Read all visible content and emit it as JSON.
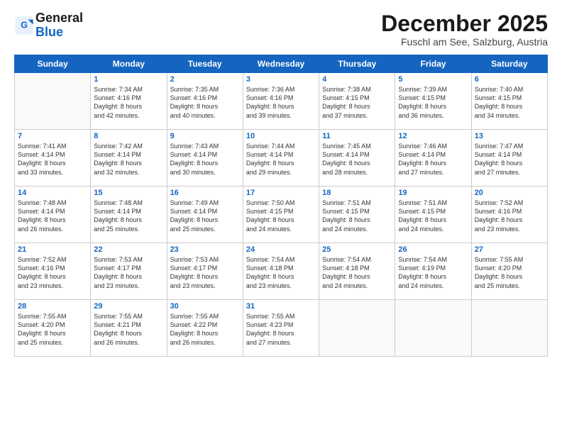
{
  "logo": {
    "line1": "General",
    "line2": "Blue"
  },
  "title": "December 2025",
  "subtitle": "Fuschl am See, Salzburg, Austria",
  "days_of_week": [
    "Sunday",
    "Monday",
    "Tuesday",
    "Wednesday",
    "Thursday",
    "Friday",
    "Saturday"
  ],
  "weeks": [
    [
      {
        "num": "",
        "info": ""
      },
      {
        "num": "1",
        "info": "Sunrise: 7:34 AM\nSunset: 4:16 PM\nDaylight: 8 hours\nand 42 minutes."
      },
      {
        "num": "2",
        "info": "Sunrise: 7:35 AM\nSunset: 4:16 PM\nDaylight: 8 hours\nand 40 minutes."
      },
      {
        "num": "3",
        "info": "Sunrise: 7:36 AM\nSunset: 4:16 PM\nDaylight: 8 hours\nand 39 minutes."
      },
      {
        "num": "4",
        "info": "Sunrise: 7:38 AM\nSunset: 4:15 PM\nDaylight: 8 hours\nand 37 minutes."
      },
      {
        "num": "5",
        "info": "Sunrise: 7:39 AM\nSunset: 4:15 PM\nDaylight: 8 hours\nand 36 minutes."
      },
      {
        "num": "6",
        "info": "Sunrise: 7:40 AM\nSunset: 4:15 PM\nDaylight: 8 hours\nand 34 minutes."
      }
    ],
    [
      {
        "num": "7",
        "info": "Sunrise: 7:41 AM\nSunset: 4:14 PM\nDaylight: 8 hours\nand 33 minutes."
      },
      {
        "num": "8",
        "info": "Sunrise: 7:42 AM\nSunset: 4:14 PM\nDaylight: 8 hours\nand 32 minutes."
      },
      {
        "num": "9",
        "info": "Sunrise: 7:43 AM\nSunset: 4:14 PM\nDaylight: 8 hours\nand 30 minutes."
      },
      {
        "num": "10",
        "info": "Sunrise: 7:44 AM\nSunset: 4:14 PM\nDaylight: 8 hours\nand 29 minutes."
      },
      {
        "num": "11",
        "info": "Sunrise: 7:45 AM\nSunset: 4:14 PM\nDaylight: 8 hours\nand 28 minutes."
      },
      {
        "num": "12",
        "info": "Sunrise: 7:46 AM\nSunset: 4:14 PM\nDaylight: 8 hours\nand 27 minutes."
      },
      {
        "num": "13",
        "info": "Sunrise: 7:47 AM\nSunset: 4:14 PM\nDaylight: 8 hours\nand 27 minutes."
      }
    ],
    [
      {
        "num": "14",
        "info": "Sunrise: 7:48 AM\nSunset: 4:14 PM\nDaylight: 8 hours\nand 26 minutes."
      },
      {
        "num": "15",
        "info": "Sunrise: 7:48 AM\nSunset: 4:14 PM\nDaylight: 8 hours\nand 25 minutes."
      },
      {
        "num": "16",
        "info": "Sunrise: 7:49 AM\nSunset: 4:14 PM\nDaylight: 8 hours\nand 25 minutes."
      },
      {
        "num": "17",
        "info": "Sunrise: 7:50 AM\nSunset: 4:15 PM\nDaylight: 8 hours\nand 24 minutes."
      },
      {
        "num": "18",
        "info": "Sunrise: 7:51 AM\nSunset: 4:15 PM\nDaylight: 8 hours\nand 24 minutes."
      },
      {
        "num": "19",
        "info": "Sunrise: 7:51 AM\nSunset: 4:15 PM\nDaylight: 8 hours\nand 24 minutes."
      },
      {
        "num": "20",
        "info": "Sunrise: 7:52 AM\nSunset: 4:16 PM\nDaylight: 8 hours\nand 23 minutes."
      }
    ],
    [
      {
        "num": "21",
        "info": "Sunrise: 7:52 AM\nSunset: 4:16 PM\nDaylight: 8 hours\nand 23 minutes."
      },
      {
        "num": "22",
        "info": "Sunrise: 7:53 AM\nSunset: 4:17 PM\nDaylight: 8 hours\nand 23 minutes."
      },
      {
        "num": "23",
        "info": "Sunrise: 7:53 AM\nSunset: 4:17 PM\nDaylight: 8 hours\nand 23 minutes."
      },
      {
        "num": "24",
        "info": "Sunrise: 7:54 AM\nSunset: 4:18 PM\nDaylight: 8 hours\nand 23 minutes."
      },
      {
        "num": "25",
        "info": "Sunrise: 7:54 AM\nSunset: 4:18 PM\nDaylight: 8 hours\nand 24 minutes."
      },
      {
        "num": "26",
        "info": "Sunrise: 7:54 AM\nSunset: 4:19 PM\nDaylight: 8 hours\nand 24 minutes."
      },
      {
        "num": "27",
        "info": "Sunrise: 7:55 AM\nSunset: 4:20 PM\nDaylight: 8 hours\nand 25 minutes."
      }
    ],
    [
      {
        "num": "28",
        "info": "Sunrise: 7:55 AM\nSunset: 4:20 PM\nDaylight: 8 hours\nand 25 minutes."
      },
      {
        "num": "29",
        "info": "Sunrise: 7:55 AM\nSunset: 4:21 PM\nDaylight: 8 hours\nand 26 minutes."
      },
      {
        "num": "30",
        "info": "Sunrise: 7:55 AM\nSunset: 4:22 PM\nDaylight: 8 hours\nand 26 minutes."
      },
      {
        "num": "31",
        "info": "Sunrise: 7:55 AM\nSunset: 4:23 PM\nDaylight: 8 hours\nand 27 minutes."
      },
      {
        "num": "",
        "info": ""
      },
      {
        "num": "",
        "info": ""
      },
      {
        "num": "",
        "info": ""
      }
    ]
  ]
}
